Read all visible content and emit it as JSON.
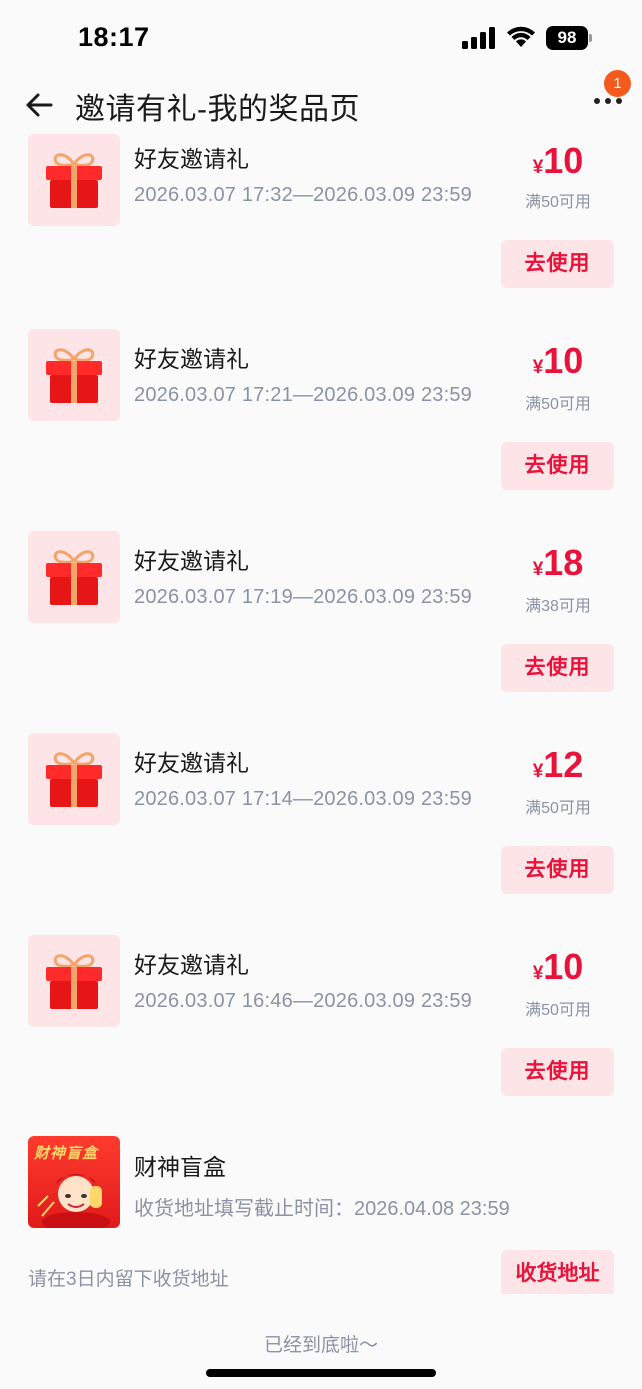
{
  "status": {
    "time": "18:17",
    "battery": "98"
  },
  "nav": {
    "title": "邀请有礼-我的奖品页",
    "badge_count": "1"
  },
  "coupons": [
    {
      "title": "好友邀请礼",
      "time": "2026.03.07 17:32—2026.03.09 23:59",
      "currency": "¥",
      "amount": "10",
      "condition": "满50可用",
      "button": "去使用"
    },
    {
      "title": "好友邀请礼",
      "time": "2026.03.07 17:21—2026.03.09 23:59",
      "currency": "¥",
      "amount": "10",
      "condition": "满50可用",
      "button": "去使用"
    },
    {
      "title": "好友邀请礼",
      "time": "2026.03.07 17:19—2026.03.09 23:59",
      "currency": "¥",
      "amount": "18",
      "condition": "满38可用",
      "button": "去使用"
    },
    {
      "title": "好友邀请礼",
      "time": "2026.03.07 17:14—2026.03.09 23:59",
      "currency": "¥",
      "amount": "12",
      "condition": "满50可用",
      "button": "去使用"
    },
    {
      "title": "好友邀请礼",
      "time": "2026.03.07 16:46—2026.03.09 23:59",
      "currency": "¥",
      "amount": "10",
      "condition": "满50可用",
      "button": "去使用"
    }
  ],
  "blindbox": {
    "image_text": "财神盲盒",
    "title": "财神盲盒",
    "deadline": "收货地址填写截止时间：2026.04.08 23:59",
    "hint": "请在3日内留下收货地址",
    "button": "收货地址"
  },
  "footer": {
    "end_text": "已经到底啦～"
  },
  "colors": {
    "accent": "#e8123a",
    "button_bg": "#fde4e7",
    "badge": "#f55a1c",
    "muted": "#8a93a3"
  }
}
